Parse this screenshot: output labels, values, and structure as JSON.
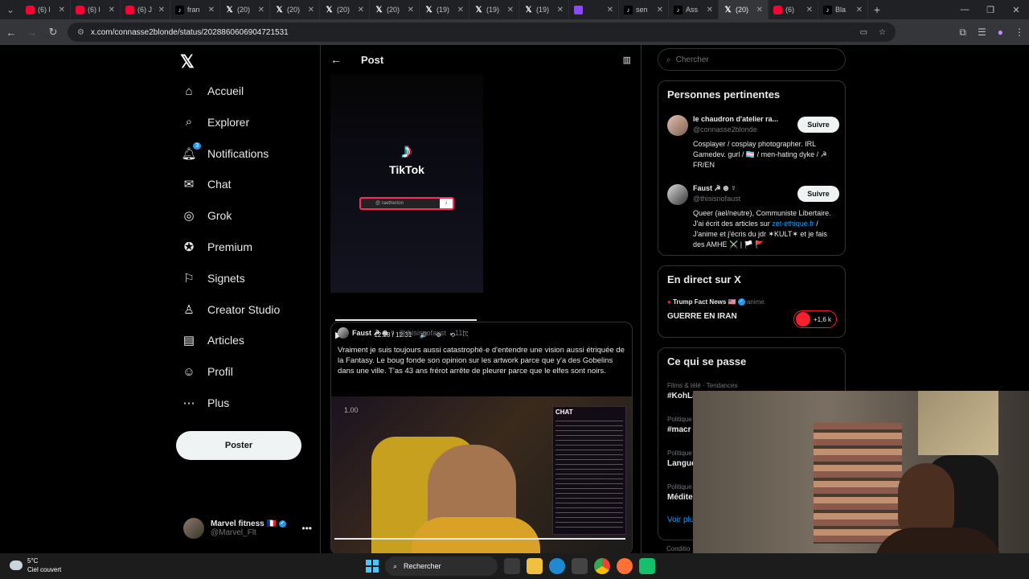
{
  "browser": {
    "tabs": [
      {
        "favicon": "youtube",
        "title": "(6) l"
      },
      {
        "favicon": "youtube",
        "title": "(6) l"
      },
      {
        "favicon": "youtube",
        "title": "(6) J"
      },
      {
        "favicon": "tiktok",
        "title": "fran"
      },
      {
        "favicon": "x",
        "title": "(20)"
      },
      {
        "favicon": "x",
        "title": "(20)"
      },
      {
        "favicon": "x",
        "title": "(20)"
      },
      {
        "favicon": "x",
        "title": "(20)"
      },
      {
        "favicon": "x",
        "title": "(19)"
      },
      {
        "favicon": "x",
        "title": "(19)"
      },
      {
        "favicon": "x",
        "title": "(19)"
      },
      {
        "favicon": "twitch",
        "title": ""
      },
      {
        "favicon": "tiktok",
        "title": "sen"
      },
      {
        "favicon": "tiktok",
        "title": "Ass"
      },
      {
        "favicon": "x",
        "title": "(20)",
        "active": true
      },
      {
        "favicon": "youtube",
        "title": "(6)"
      },
      {
        "favicon": "tiktok",
        "title": "Bla"
      }
    ],
    "url": "x.com/connasse2blonde/status/2028860606904721531"
  },
  "nav": {
    "items": [
      {
        "label": "Accueil",
        "icon": "home-icon"
      },
      {
        "label": "Explorer",
        "icon": "search-icon"
      },
      {
        "label": "Notifications",
        "icon": "bell-icon",
        "badge": "3"
      },
      {
        "label": "Chat",
        "icon": "mail-icon"
      },
      {
        "label": "Grok",
        "icon": "grok-icon"
      },
      {
        "label": "Premium",
        "icon": "premium-icon"
      },
      {
        "label": "Signets",
        "icon": "bookmark-icon"
      },
      {
        "label": "Creator Studio",
        "icon": "creator-studio-icon"
      },
      {
        "label": "Articles",
        "icon": "articles-icon"
      },
      {
        "label": "Profil",
        "icon": "profile-icon"
      },
      {
        "label": "Plus",
        "icon": "more-icon"
      }
    ],
    "post_button": "Poster",
    "account": {
      "name": "Marvel fitness",
      "flag": "🇫🇷",
      "handle": "@Marvel_Flt"
    }
  },
  "main": {
    "header_title": "Post",
    "video1": {
      "brand": "TikTok",
      "search_text": "@ raetherion",
      "time": "12:28 / 12:31",
      "progress": 0.99
    },
    "quoted": {
      "name": "Faust ☭ ⊛ ☿",
      "handle": "@thisisnofaust",
      "age": "11h",
      "text": "Vraiment je suis toujours aussi catastrophé·e d'entendre une vision aussi étriquée de la Fantasy. Le boug fonde son opinion sur les artwork parce que y'a des Gobelins dans une ville. T'as 43 ans frérot arrête de pleurer parce que le elfes sont noirs.",
      "speed": "1.00",
      "chat_label": "CHAT",
      "time": "0:50 / 1:00"
    }
  },
  "right": {
    "search_placeholder": "Chercher",
    "relevant": {
      "title": "Personnes pertinentes",
      "people": [
        {
          "name": "le chaudron d'atelier ra...",
          "handle": "@connasse2blonde",
          "follow": "Suivre",
          "bio": "Cosplayer / cosplay photographer. IRL Gamedev. gurl / 🏳️‍⚧️ / men-hating dyke / ☭ FR/EN"
        },
        {
          "name": "Faust ☭ ⊛ ☿",
          "handle": "@thisisnofaust",
          "follow": "Suivre",
          "bio_pre": "Queer (ael/neutre), Communiste Libertaire. J'ai écrit des articles sur ",
          "bio_link": "zet-ethique.fr",
          "bio_post": " / J'anime et j'écris du jdr ✶KULT✶ et je fais des AMHE ⚔️ | 🏳️ 🚩"
        }
      ]
    },
    "live": {
      "title": "En direct sur X",
      "host": "Trump Fact News 🇺🇸",
      "host_suffix": "anime.",
      "headline": "GUERRE EN IRAN",
      "count": "+1,6 k"
    },
    "happening": {
      "title": "Ce qui se passe",
      "trends": [
        {
          "context": "Films & télé · Tendances",
          "name": "#KohLa"
        },
        {
          "context": "Politique",
          "name": "#macr"
        },
        {
          "context": "Politique",
          "name": "Langue"
        },
        {
          "context": "Politique",
          "name": "Médite"
        }
      ],
      "see_more": "Voir plu"
    },
    "footer": "Conditio"
  },
  "taskbar": {
    "temp": "5°C",
    "weather": "Ciel couvert",
    "search": "Rechercher"
  },
  "colors": {
    "accent": "#1d9bf0",
    "background": "#000000",
    "tiktok_red": "#fe2c55",
    "live_red": "#f4212e"
  }
}
